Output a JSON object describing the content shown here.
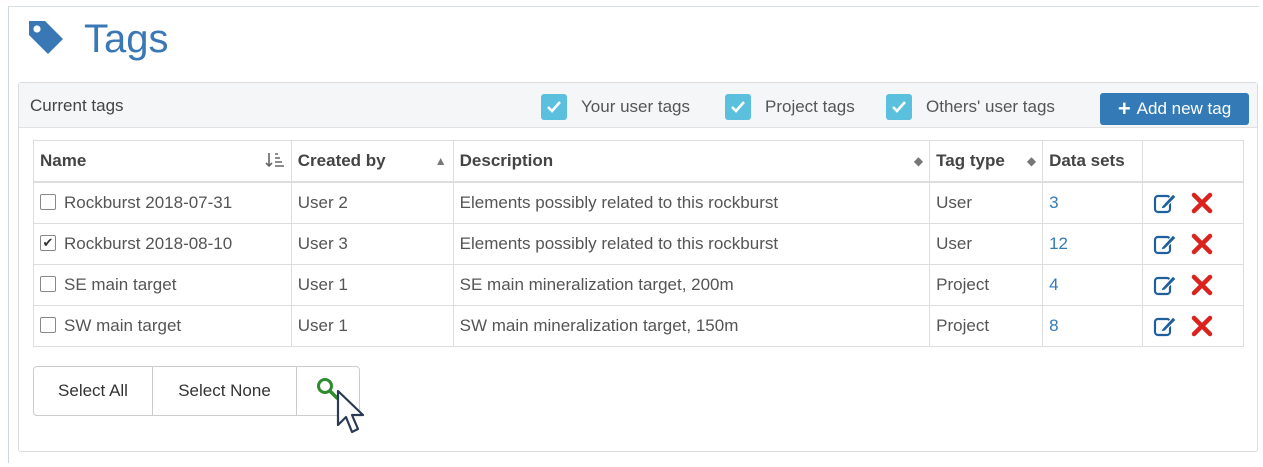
{
  "page": {
    "title": "Tags"
  },
  "panel": {
    "heading": "Current tags",
    "filters": [
      {
        "label": "Your user tags",
        "checked": true
      },
      {
        "label": "Project tags",
        "checked": true
      },
      {
        "label": "Others' user tags",
        "checked": true
      }
    ],
    "add_button": "Add new tag"
  },
  "table": {
    "columns": [
      "Name",
      "Created by",
      "Description",
      "Tag type",
      "Data sets"
    ],
    "rows": [
      {
        "checked": false,
        "name": "Rockburst 2018-07-31",
        "created_by": "User 2",
        "description": "Elements possibly related to this rockburst",
        "tag_type": "User",
        "data_sets": "3"
      },
      {
        "checked": true,
        "name": "Rockburst 2018-08-10",
        "created_by": "User 3",
        "description": "Elements possibly related to this rockburst",
        "tag_type": "User",
        "data_sets": "12"
      },
      {
        "checked": false,
        "name": "SE main target",
        "created_by": "User 1",
        "description": "SE main mineralization target, 200m",
        "tag_type": "Project",
        "data_sets": "4"
      },
      {
        "checked": false,
        "name": "SW main target",
        "created_by": "User 1",
        "description": "SW main mineralization target, 150m",
        "tag_type": "Project",
        "data_sets": "8"
      }
    ]
  },
  "footer": {
    "select_all": "Select All",
    "select_none": "Select None"
  },
  "icons": {
    "tag": "tag-icon",
    "filter_check": "checkmark-icon",
    "edit": "edit-icon",
    "delete": "delete-icon",
    "search": "search-icon",
    "cursor": "mouse-pointer-icon"
  },
  "colors": {
    "title": "#3a78b5",
    "primary_button": "#337ab7",
    "filter_checkbox": "#5bc0de",
    "delete": "#d9231c",
    "search": "#2e8b2e"
  }
}
